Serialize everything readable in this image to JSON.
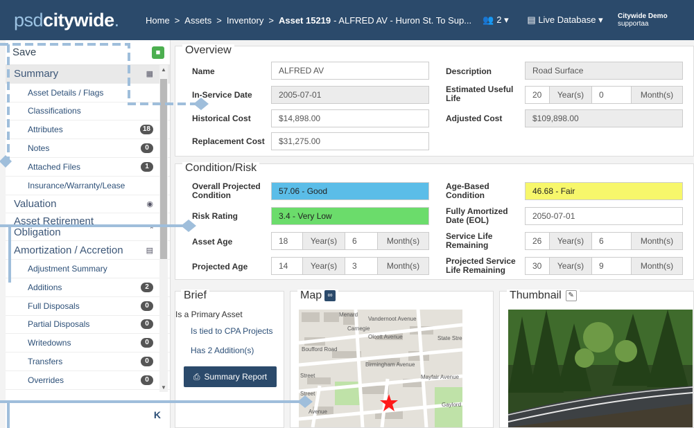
{
  "brand": {
    "part1": "psd",
    "part2": "citywide",
    "dot": "."
  },
  "breadcrumb": {
    "home": "Home",
    "assets": "Assets",
    "inventory": "Inventory",
    "current_bold": "Asset 15219",
    "current_rest": "- ALFRED AV - Huron St. To Sup..."
  },
  "header": {
    "users_count": "2",
    "database": "Live Database",
    "user_name": "Citywide Demo",
    "user_login": "supportaa"
  },
  "sidebar": {
    "save_label": "Save",
    "items": [
      {
        "label": "Summary",
        "type": "sec",
        "active": true,
        "icon": "calculator-icon",
        "badge": ""
      },
      {
        "label": "Asset Details / Flags",
        "type": "sub",
        "badge": ""
      },
      {
        "label": "Classifications",
        "type": "sub",
        "badge": ""
      },
      {
        "label": "Attributes",
        "type": "sub",
        "badge": "18"
      },
      {
        "label": "Notes",
        "type": "sub",
        "badge": "0"
      },
      {
        "label": "Attached Files",
        "type": "sub",
        "badge": "1"
      },
      {
        "label": "Insurance/Warranty/Lease",
        "type": "sub",
        "badge": ""
      },
      {
        "label": "Valuation",
        "type": "sec",
        "icon": "coins-icon",
        "badge": ""
      },
      {
        "label": "Asset Retirement Obligation",
        "type": "sec2",
        "icon": "exit-icon",
        "badge": ""
      },
      {
        "label": "Amortization / Accretion",
        "type": "sec",
        "icon": "chart-icon",
        "badge": ""
      },
      {
        "label": "Adjustment Summary",
        "type": "sub",
        "badge": ""
      },
      {
        "label": "Additions",
        "type": "sub",
        "badge": "2"
      },
      {
        "label": "Full Disposals",
        "type": "sub",
        "badge": "0"
      },
      {
        "label": "Partial Disposals",
        "type": "sub",
        "badge": "0"
      },
      {
        "label": "Writedowns",
        "type": "sub",
        "badge": "0"
      },
      {
        "label": "Transfers",
        "type": "sub",
        "badge": "0"
      },
      {
        "label": "Overrides",
        "type": "sub",
        "badge": "0"
      }
    ],
    "collapse_label": "K"
  },
  "overview": {
    "title": "Overview",
    "name_label": "Name",
    "name_value": "ALFRED AV",
    "inservice_label": "In-Service Date",
    "inservice_value": "2005-07-01",
    "hist_label": "Historical Cost",
    "hist_value": "$14,898.00",
    "repl_label": "Replacement Cost",
    "repl_value": "$31,275.00",
    "desc_label": "Description",
    "desc_value": "Road Surface",
    "eul_label": "Estimated Useful Life",
    "eul_years": "20",
    "eul_months": "0",
    "adj_label": "Adjusted Cost",
    "adj_value": "$109,898.00",
    "years_unit": "Year(s)",
    "months_unit": "Month(s)"
  },
  "condition": {
    "title": "Condition/Risk",
    "opc_label": "Overall Projected Condition",
    "opc_value": "57.06 - Good",
    "risk_label": "Risk Rating",
    "risk_value": "3.4 - Very Low",
    "age_label": "Asset Age",
    "age_years": "18",
    "age_months": "6",
    "proj_label": "Projected Age",
    "proj_years": "14",
    "proj_months": "3",
    "abc_label": "Age-Based Condition",
    "abc_value": "46.68 - Fair",
    "fad_label": "Fully Amortized Date (EOL)",
    "fad_value": "2050-07-01",
    "slr_label": "Service Life Remaining",
    "slr_years": "26",
    "slr_months": "6",
    "pslr_label": "Projected Service Life Remaining",
    "pslr_years": "30",
    "pslr_months": "9",
    "colors": {
      "good": "#5bbde8",
      "verylow": "#6bdc6b",
      "fair": "#f7f76b"
    }
  },
  "brief": {
    "title": "Brief",
    "line1": "Is a Primary Asset",
    "line2": "Is tied to CPA Projects",
    "line3": "Has 2 Addition(s)",
    "report_button": "Summary Report"
  },
  "map": {
    "title": "Map",
    "streets": [
      "Vandernoot Avenue",
      "Olcott Avenue",
      "Birmingham Avenue",
      "Boufford Road",
      "Carnegie",
      "Menard",
      "State Street",
      "Mayfair Avenue",
      "Gaylord Avenue",
      "Street",
      "Street",
      "Avenue"
    ]
  },
  "thumbnail": {
    "title": "Thumbnail"
  }
}
